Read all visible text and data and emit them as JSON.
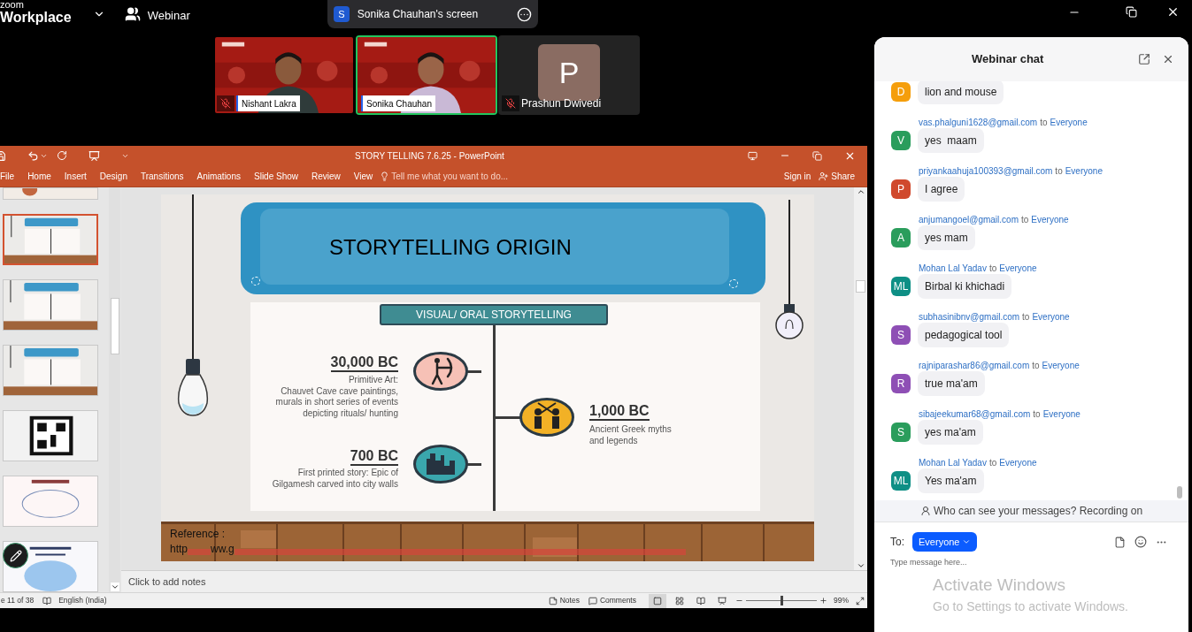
{
  "app": {
    "brand_top": "zoom",
    "brand_bottom": "Workplace",
    "mode": "Webinar"
  },
  "share_banner": {
    "badge": "S",
    "title": "Sonika Chauhan's screen"
  },
  "participants": [
    {
      "name": "Nishant Lakra",
      "kind": "video",
      "muted": true,
      "selected": false
    },
    {
      "name": "Sonika Chauhan",
      "kind": "video",
      "muted": false,
      "selected": true
    },
    {
      "name": "Prashun Dwivedi",
      "kind": "avatar",
      "initial": "P",
      "muted": true,
      "selected": false
    }
  ],
  "powerpoint": {
    "title": "STORY TELLING 7.6.25 - PowerPoint",
    "tabs": [
      "File",
      "Home",
      "Insert",
      "Design",
      "Transitions",
      "Animations",
      "Slide Show",
      "Review",
      "View"
    ],
    "tell_me": "Tell me what you want to do...",
    "sign_in": "Sign in",
    "share": "Share",
    "thumbnails": [
      {
        "kind": "partial",
        "selected": false
      },
      {
        "kind": "timeline",
        "selected": true
      },
      {
        "kind": "timeline",
        "selected": false
      },
      {
        "kind": "timeline",
        "selected": false
      },
      {
        "kind": "qr",
        "selected": false
      },
      {
        "kind": "diagram",
        "selected": false
      },
      {
        "kind": "text",
        "selected": false
      }
    ],
    "slide": {
      "title": "STORYTELLING ORIGIN",
      "banner": "VISUAL/ ORAL STORYTELLING",
      "events": [
        {
          "date": "30,000 BC",
          "lines": [
            "Primitive Art:",
            "Chauvet Cave cave paintings,",
            "murals in short series of events",
            "depicting rituals/ hunting"
          ],
          "color": "#f6c1b6"
        },
        {
          "date": "1,000 BC",
          "lines": [
            "Ancient Greek myths",
            "and legends"
          ],
          "color": "#f2b126"
        },
        {
          "date": "700 BC",
          "lines": [
            "First printed story: Epic of",
            "Gilgamesh carved into city walls"
          ],
          "color": "#3aa7ad"
        }
      ],
      "reference_label": "Reference :",
      "reference_start": "http",
      "reference_mid": "ww.g"
    },
    "notes_placeholder": "Click to add notes",
    "status": {
      "slide_count": "e 11 of 38",
      "language": "English (India)",
      "notes": "Notes",
      "comments": "Comments",
      "zoom": "99%",
      "zoom_slider": {
        "level": 0.5
      }
    }
  },
  "chat": {
    "title": "Webinar chat",
    "messages": [
      {
        "initial": "D",
        "color": "#f59e0b",
        "text": "lion and mouse"
      },
      {
        "sender": "vas.phalguni1628@gmail.com",
        "joiner": "to",
        "recipient": "Everyone",
        "initial": "V",
        "color": "#2a9d5c",
        "text": "yes  maam"
      },
      {
        "sender": "priyankaahuja100393@gmail.com",
        "joiner": "to",
        "recipient": "Everyone",
        "initial": "P",
        "color": "#d0492d",
        "text": "I agree"
      },
      {
        "sender": "anjumangoel@gmail.com",
        "joiner": "to",
        "recipient": "Everyone",
        "initial": "A",
        "color": "#2a9d5c",
        "text": "yes mam"
      },
      {
        "sender": "Mohan Lal Yadav",
        "joiner": "to",
        "recipient": "Everyone",
        "initial": "ML",
        "color": "#0e8f85",
        "text": "Birbal ki khichadi"
      },
      {
        "sender": "subhasinibnv@gmail.com",
        "joiner": "to",
        "recipient": "Everyone",
        "initial": "S",
        "color": "#8e4fb5",
        "text": "pedagogical tool"
      },
      {
        "sender": "rajniparashar86@gmail.com",
        "joiner": "to",
        "recipient": "Everyone",
        "initial": "R",
        "color": "#8e4fb5",
        "text": "true ma'am"
      },
      {
        "sender": "sibajeekumar68@gmail.com",
        "joiner": "to",
        "recipient": "Everyone",
        "initial": "S",
        "color": "#2a9d5c",
        "text": "yes ma'am"
      },
      {
        "sender": "Mohan Lal Yadav",
        "joiner": "to",
        "recipient": "Everyone",
        "initial": "ML",
        "color": "#0e8f85",
        "text": "Yes ma'am"
      }
    ],
    "privacy": "Who can see your messages? Recording on",
    "to_label": "To:",
    "recipient": "Everyone",
    "placeholder": "Type message here..."
  },
  "os_notice": {
    "title": "Activate Windows",
    "text": "Go to Settings to activate Windows."
  }
}
